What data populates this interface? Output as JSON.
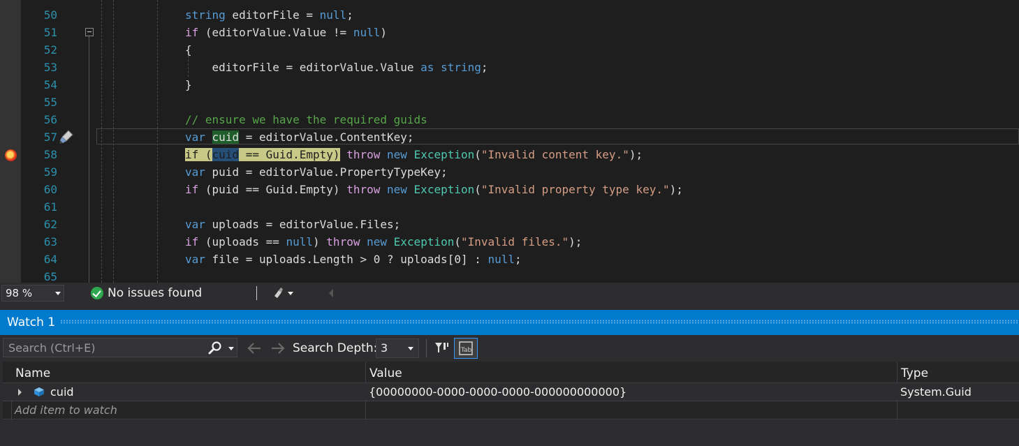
{
  "editor": {
    "lines": [
      {
        "number": "50",
        "tokens": [
          {
            "t": "string",
            "c": "kw"
          },
          {
            "t": " editorFile = ",
            "c": "plain"
          },
          {
            "t": "null",
            "c": "kw"
          },
          {
            "t": ";",
            "c": "plain"
          }
        ]
      },
      {
        "number": "51",
        "tokens": [
          {
            "t": "if",
            "c": "ctl"
          },
          {
            "t": " (editorValue.Value != ",
            "c": "plain"
          },
          {
            "t": "null",
            "c": "kw"
          },
          {
            "t": ")",
            "c": "plain"
          }
        ]
      },
      {
        "number": "52",
        "tokens": [
          {
            "t": "{",
            "c": "plain"
          }
        ]
      },
      {
        "number": "53",
        "tokens": [
          {
            "t": "    editorFile = editorValue.Value ",
            "c": "plain"
          },
          {
            "t": "as",
            "c": "kw"
          },
          {
            "t": " ",
            "c": "plain"
          },
          {
            "t": "string",
            "c": "kw"
          },
          {
            "t": ";",
            "c": "plain"
          }
        ]
      },
      {
        "number": "54",
        "tokens": [
          {
            "t": "}",
            "c": "plain"
          }
        ]
      },
      {
        "number": "55",
        "tokens": []
      },
      {
        "number": "56",
        "tokens": [
          {
            "t": "// ensure we have the required guids",
            "c": "cmt"
          }
        ]
      },
      {
        "number": "57",
        "tokens": [
          {
            "t": "var",
            "c": "kw"
          },
          {
            "t": " ",
            "c": "plain"
          },
          {
            "t": "cuid",
            "c": "plain ref-hl"
          },
          {
            "t": " = editorValue.ContentKey;",
            "c": "plain"
          }
        ]
      },
      {
        "number": "58",
        "tokens": [
          {
            "t": "if (",
            "c": "stmt-hl"
          },
          {
            "t": "cuid",
            "c": "stmt-hl ref-hl-sel"
          },
          {
            "t": " == Guid.Empty)",
            "c": "stmt-hl"
          },
          {
            "t": " ",
            "c": "plain"
          },
          {
            "t": "throw",
            "c": "ctl"
          },
          {
            "t": " ",
            "c": "plain"
          },
          {
            "t": "new",
            "c": "kw"
          },
          {
            "t": " ",
            "c": "plain"
          },
          {
            "t": "Exception",
            "c": "typ"
          },
          {
            "t": "(",
            "c": "plain"
          },
          {
            "t": "\"Invalid content key.\"",
            "c": "str"
          },
          {
            "t": ");",
            "c": "plain"
          }
        ]
      },
      {
        "number": "59",
        "tokens": [
          {
            "t": "var",
            "c": "kw"
          },
          {
            "t": " puid = editorValue.PropertyTypeKey;",
            "c": "plain"
          }
        ]
      },
      {
        "number": "60",
        "tokens": [
          {
            "t": "if",
            "c": "ctl"
          },
          {
            "t": " (puid == Guid.Empty) ",
            "c": "plain"
          },
          {
            "t": "throw",
            "c": "ctl"
          },
          {
            "t": " ",
            "c": "plain"
          },
          {
            "t": "new",
            "c": "kw"
          },
          {
            "t": " ",
            "c": "plain"
          },
          {
            "t": "Exception",
            "c": "typ"
          },
          {
            "t": "(",
            "c": "plain"
          },
          {
            "t": "\"Invalid property type key.\"",
            "c": "str"
          },
          {
            "t": ");",
            "c": "plain"
          }
        ]
      },
      {
        "number": "61",
        "tokens": []
      },
      {
        "number": "62",
        "tokens": [
          {
            "t": "var",
            "c": "kw"
          },
          {
            "t": " uploads = editorValue.Files;",
            "c": "plain"
          }
        ]
      },
      {
        "number": "63",
        "tokens": [
          {
            "t": "if",
            "c": "ctl"
          },
          {
            "t": " (uploads == ",
            "c": "plain"
          },
          {
            "t": "null",
            "c": "kw"
          },
          {
            "t": ") ",
            "c": "plain"
          },
          {
            "t": "throw",
            "c": "ctl"
          },
          {
            "t": " ",
            "c": "plain"
          },
          {
            "t": "new",
            "c": "kw"
          },
          {
            "t": " ",
            "c": "plain"
          },
          {
            "t": "Exception",
            "c": "typ"
          },
          {
            "t": "(",
            "c": "plain"
          },
          {
            "t": "\"Invalid files.\"",
            "c": "str"
          },
          {
            "t": ");",
            "c": "plain"
          }
        ]
      },
      {
        "number": "64",
        "tokens": [
          {
            "t": "var",
            "c": "kw"
          },
          {
            "t": " file = uploads.Length > 0 ? uploads[0] : ",
            "c": "plain"
          },
          {
            "t": "null",
            "c": "kw"
          },
          {
            "t": ";",
            "c": "plain"
          }
        ]
      },
      {
        "number": "65",
        "tokens": []
      }
    ]
  },
  "status_bar": {
    "zoom": "98 %",
    "issues": "No issues found"
  },
  "watch": {
    "title": "Watch 1",
    "search_placeholder": "Search (Ctrl+E)",
    "search_depth_label": "Search Depth:",
    "search_depth_value": "3",
    "columns": {
      "name": "Name",
      "value": "Value",
      "type": "Type"
    },
    "rows": [
      {
        "name": "cuid",
        "value": "{00000000-0000-0000-0000-000000000000}",
        "type": "System.Guid"
      }
    ],
    "add_item_placeholder": "Add item to watch"
  },
  "colors": {
    "keyword": "#569cd6",
    "control": "#d8a0df",
    "type": "#4ec9b0",
    "string": "#d69d85",
    "comment": "#57a64a",
    "line_number": "#2b91af",
    "accent": "#007acc",
    "statement_highlight": "#c8c887"
  },
  "icons": [
    "breakpoint-icon",
    "edit-and-continue-icon",
    "collapse-icon",
    "check-icon",
    "code-cleanup-icon",
    "search-icon",
    "back-arrow-icon",
    "forward-arrow-icon",
    "filter-icon",
    "tab-icon",
    "expand-icon",
    "field-icon"
  ]
}
